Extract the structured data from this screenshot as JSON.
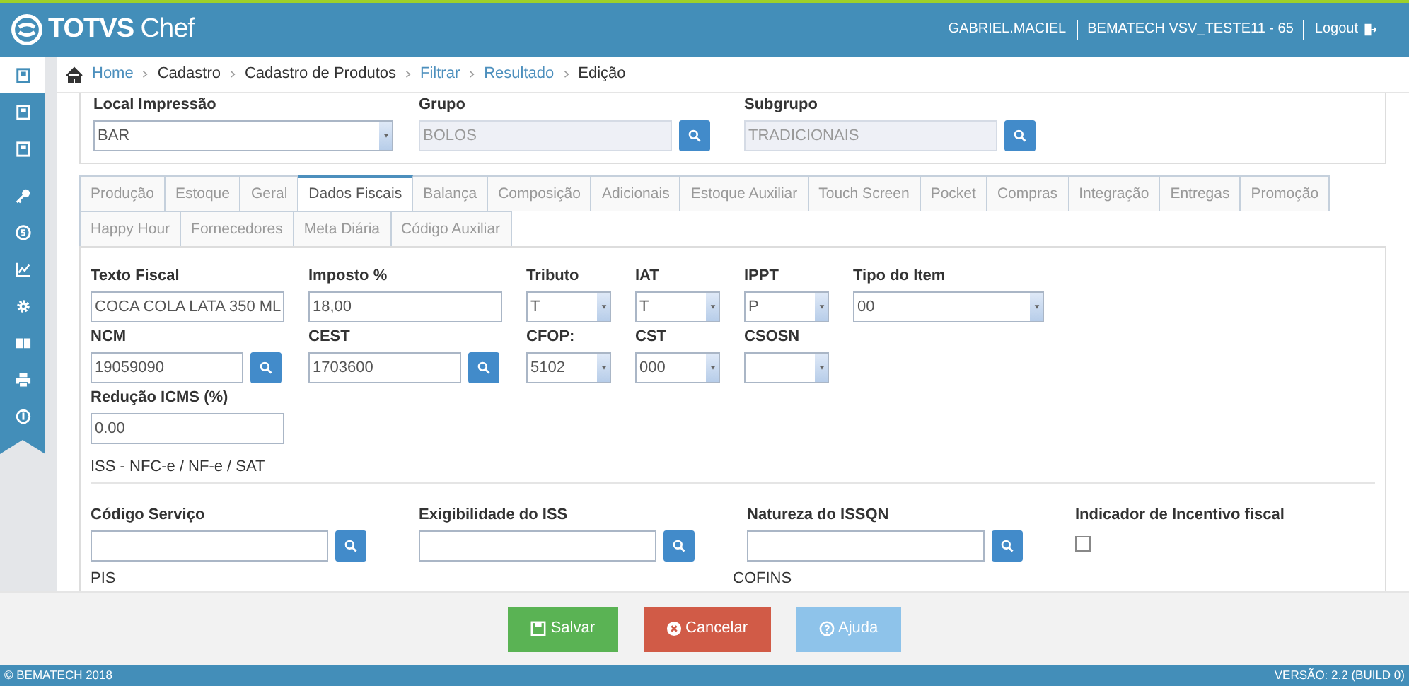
{
  "header": {
    "logo": "**TOTVS** Chef",
    "user": "GABRIEL.MACIEL",
    "store": "BEMATECH VSV_TESTE11 - 65",
    "logout": "Logout"
  },
  "sidebar": {
    "items": [
      {
        "kind": "document",
        "selected": true
      },
      {
        "kind": "document",
        "selected": false
      },
      {
        "kind": "document",
        "selected": false
      },
      {
        "kind": "key",
        "selected": false
      },
      {
        "kind": "coin",
        "selected": false
      },
      {
        "kind": "chart",
        "selected": false
      },
      {
        "kind": "gear",
        "selected": false
      },
      {
        "kind": "book",
        "selected": false
      },
      {
        "kind": "printer",
        "selected": false
      },
      {
        "kind": "info",
        "selected": false
      }
    ]
  },
  "breadcrumb": [
    {
      "label": "Home",
      "kind": "link"
    },
    {
      "label": "Cadastro",
      "kind": "text"
    },
    {
      "label": "Cadastro de Produtos",
      "kind": "text"
    },
    {
      "label": "Filtrar",
      "kind": "link"
    },
    {
      "label": "Resultado",
      "kind": "link"
    },
    {
      "label": "Edição",
      "kind": "text"
    }
  ],
  "top_fields": [
    {
      "kind": "select",
      "label": "Local Impressão",
      "value": "BAR"
    },
    {
      "kind": "lookup",
      "label": "Grupo",
      "value": "BOLOS",
      "disabled": true
    },
    {
      "kind": "lookup",
      "label": "Subgrupo",
      "value": "TRADICIONAIS",
      "disabled": true
    }
  ],
  "tab_rows": [
    [
      {
        "label": "Produção",
        "selected": false
      },
      {
        "label": "Estoque",
        "selected": false
      },
      {
        "label": "Geral",
        "selected": false
      },
      {
        "label": "Dados Fiscais",
        "selected": true
      },
      {
        "label": "Balança",
        "selected": false
      },
      {
        "label": "Composição",
        "selected": false
      },
      {
        "label": "Adicionais",
        "selected": false
      },
      {
        "label": "Estoque Auxiliar",
        "selected": false
      },
      {
        "label": "Touch Screen",
        "selected": false
      },
      {
        "label": "Pocket",
        "selected": false
      },
      {
        "label": "Compras",
        "selected": false
      },
      {
        "label": "Integração",
        "selected": false
      },
      {
        "label": "Entregas",
        "selected": false
      },
      {
        "label": "Promoção",
        "selected": false
      }
    ],
    [
      {
        "label": "Happy Hour",
        "selected": false
      },
      {
        "label": "Fornecedores",
        "selected": false
      },
      {
        "label": "Meta Diária",
        "selected": false
      },
      {
        "label": "Código Auxiliar",
        "selected": false
      }
    ]
  ],
  "fiscal_rows": [
    [
      {
        "kind": "text",
        "label": "Texto Fiscal",
        "value": "COCA COLA LATA 350 ML"
      },
      {
        "kind": "text",
        "label": "Imposto %",
        "value": "18,00"
      },
      {
        "kind": "select",
        "label": "Tributo",
        "value": "T"
      },
      {
        "kind": "select",
        "label": "IAT",
        "value": "T"
      },
      {
        "kind": "select",
        "label": "IPPT",
        "value": "P"
      },
      {
        "kind": "select",
        "label": "Tipo do Item",
        "value": "00"
      }
    ],
    [
      {
        "kind": "lookup",
        "label": "NCM",
        "value": "19059090"
      },
      {
        "kind": "lookup",
        "label": "CEST",
        "value": "1703600"
      },
      {
        "kind": "select",
        "label": "CFOP:",
        "value": "5102"
      },
      {
        "kind": "select",
        "label": "CST",
        "value": "000"
      },
      {
        "kind": "select",
        "label": "CSOSN"
      }
    ],
    [
      {
        "kind": "text",
        "label": "Redução ICMS (%)",
        "value": "0.00"
      }
    ]
  ],
  "iss": {
    "title": "ISS - NFC-e / NF-e / SAT",
    "fields": [
      {
        "kind": "lookup",
        "label": "Código Serviço"
      },
      {
        "kind": "lookup",
        "label": "Exigibilidade do ISS"
      },
      {
        "kind": "lookup",
        "label": "Natureza do ISSQN"
      },
      {
        "kind": "checkbox",
        "label": "Indicador de Incentivo fiscal",
        "checked": false
      }
    ]
  },
  "sections": [
    "PIS",
    "COFINS"
  ],
  "buttons": [
    {
      "kind": "success",
      "label": "Salvar"
    },
    {
      "kind": "danger",
      "label": "Cancelar"
    },
    {
      "kind": "info",
      "label": "Ajuda"
    }
  ],
  "footer": {
    "copyright": "© BEMATECH 2018",
    "version": "VERSÃO: 2.2 (BUILD 0)"
  }
}
